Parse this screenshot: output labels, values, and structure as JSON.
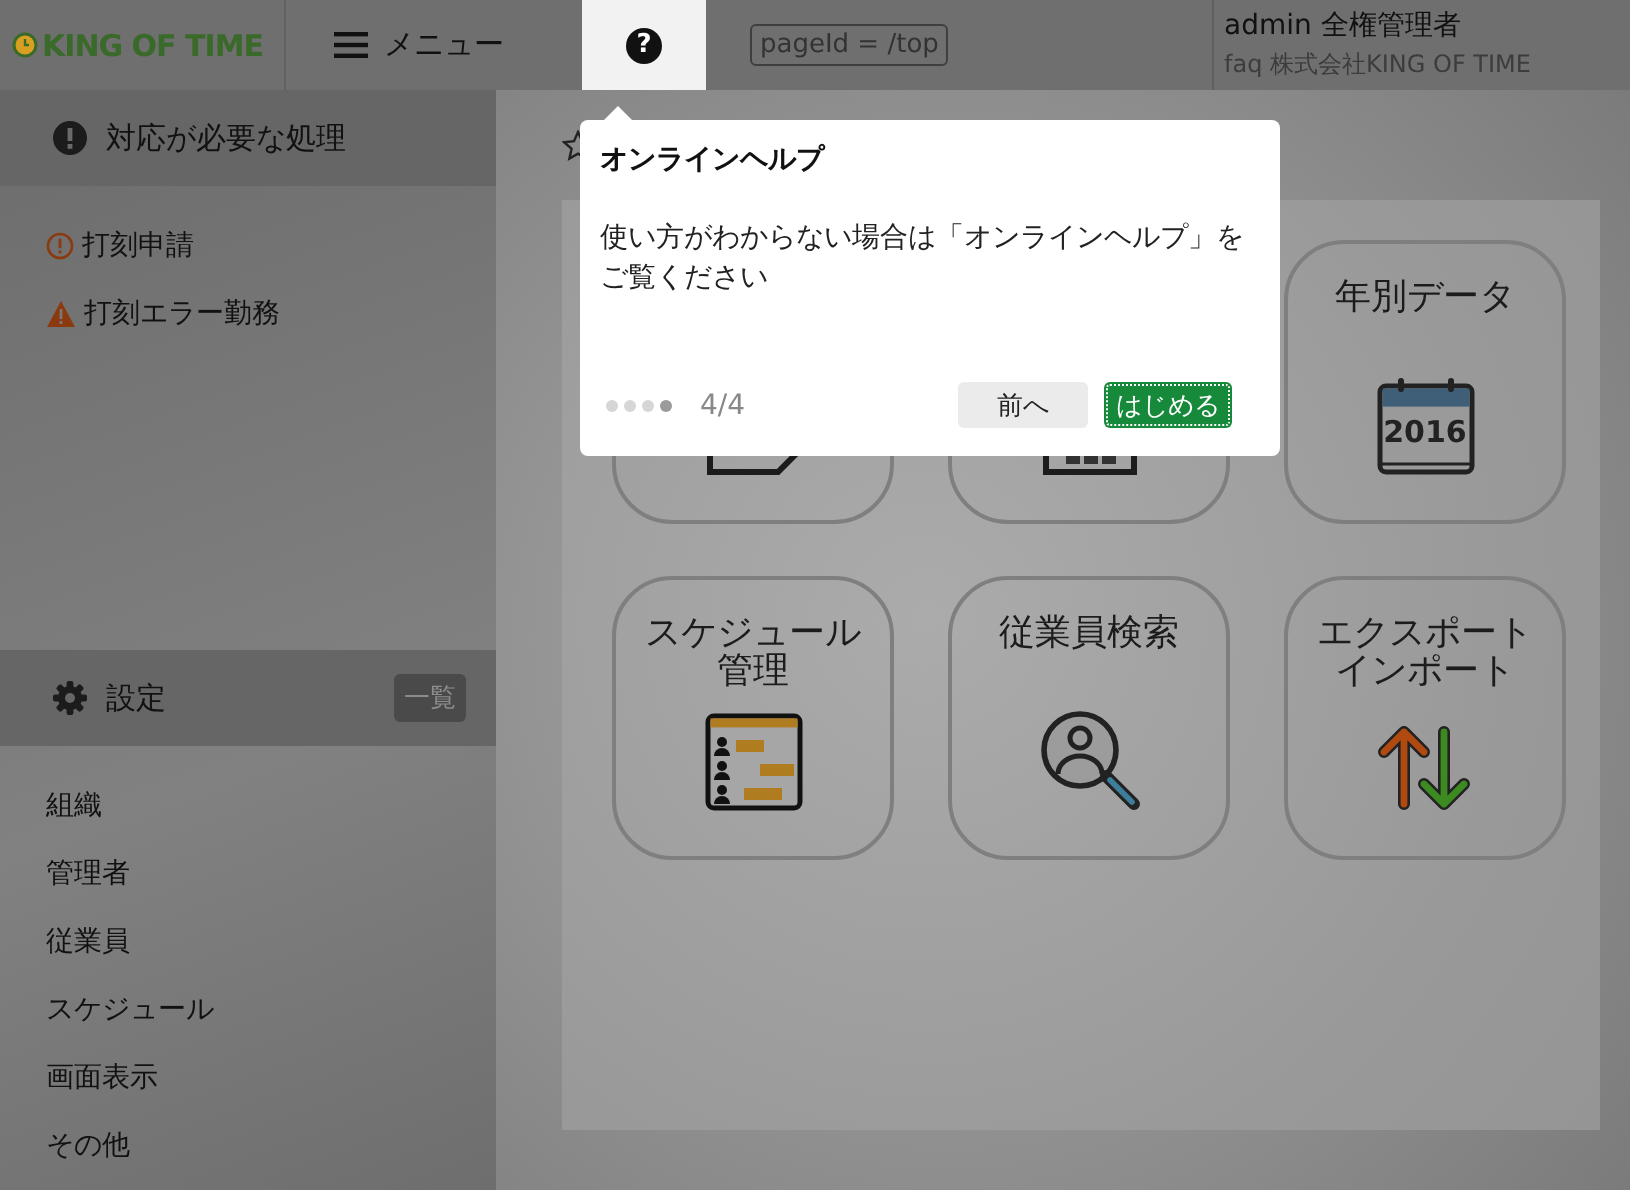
{
  "header": {
    "logo": "KING OF TIME",
    "menu_label": "メニュー",
    "help_button": "?",
    "page_id": "pageId = /top",
    "user_name": "admin 全権管理者",
    "company": "faq 株式会社KING OF TIME"
  },
  "sidebar": {
    "sections": [
      {
        "title": "対応が必要な処理",
        "kind": "alert",
        "items": [
          {
            "label": "打刻申請",
            "kind": "notice"
          },
          {
            "label": "打刻エラー勤務",
            "kind": "warning"
          }
        ]
      },
      {
        "title": "設定",
        "kind": "gear",
        "badge": "一覧",
        "items": [
          {
            "label": "組織"
          },
          {
            "label": "管理者"
          },
          {
            "label": "従業員"
          },
          {
            "label": "スケジュール"
          },
          {
            "label": "画面表示"
          },
          {
            "label": "その他"
          }
        ]
      }
    ]
  },
  "tiles": [
    {
      "kind": "document"
    },
    {
      "kind": "calendar_grid"
    },
    {
      "label_lines": [
        "年別データ"
      ],
      "kind": "calendar_year",
      "icon_text": "2016"
    },
    {
      "label_lines": [
        "スケジュール",
        "管理"
      ],
      "kind": "schedule"
    },
    {
      "label_lines": [
        "従業員検索"
      ],
      "kind": "person_search"
    },
    {
      "label_lines": [
        "エクスポート",
        "インポート"
      ],
      "kind": "import_export"
    }
  ],
  "popover": {
    "title": "オンラインヘルプ",
    "body": "使い方がわからない場合は「オンラインヘルプ」をご覧ください",
    "steps": [
      {
        "selected": false
      },
      {
        "selected": false
      },
      {
        "selected": false
      },
      {
        "selected": true
      }
    ],
    "counter": "4/4",
    "buttons": [
      {
        "label": "前へ",
        "kind": "secondary"
      },
      {
        "label": "はじめる",
        "kind": "primary"
      }
    ]
  }
}
